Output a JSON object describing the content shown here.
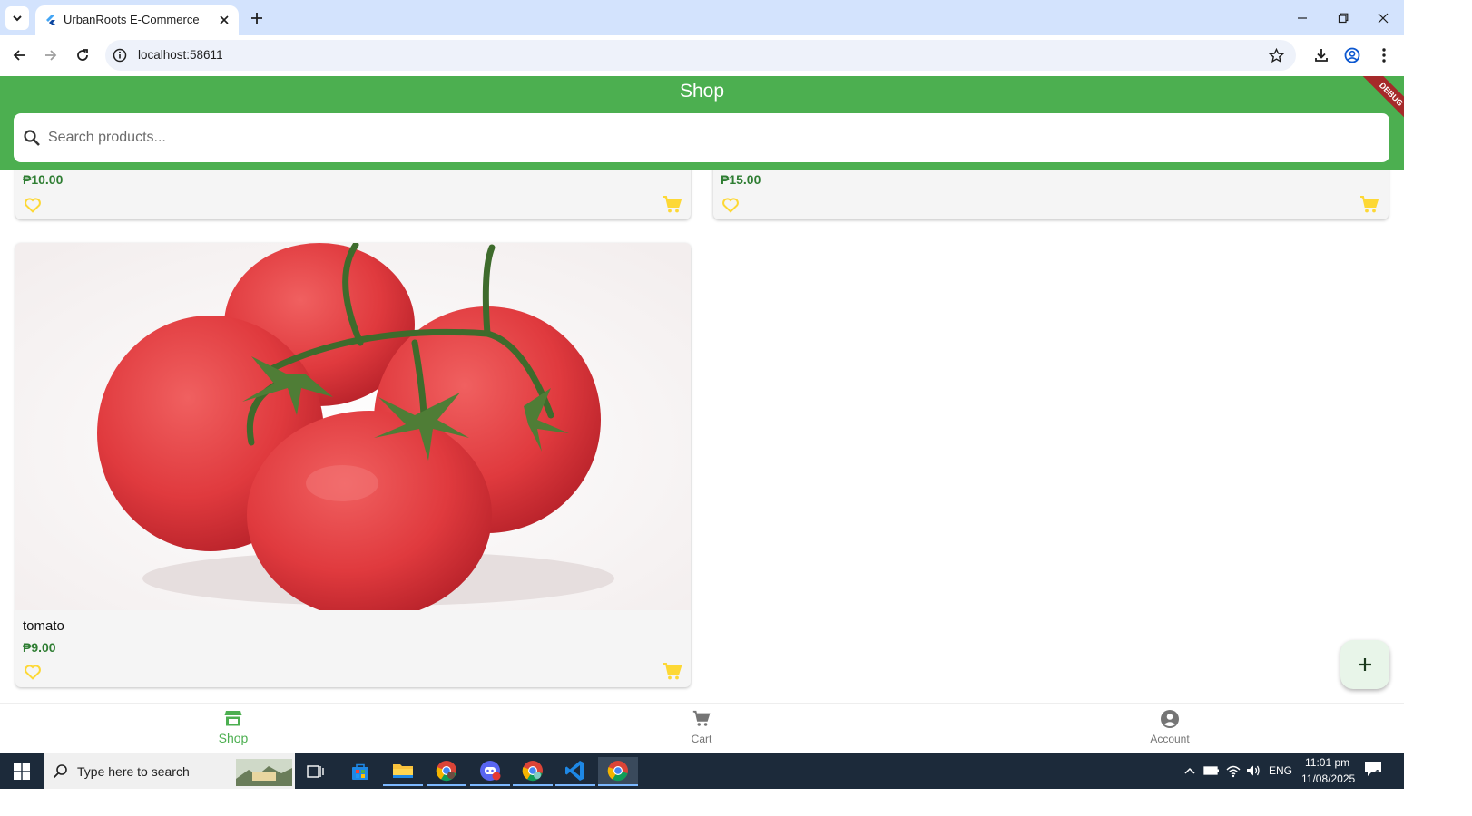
{
  "browser": {
    "tab_title": "UrbanRoots E-Commerce",
    "url": "localhost:58611"
  },
  "app": {
    "title": "Shop",
    "debug_banner": "DEBUG",
    "search_placeholder": "Search products...",
    "products": [
      {
        "name": "",
        "price": "₱10.00"
      },
      {
        "name": "",
        "price": "₱15.00"
      },
      {
        "name": "tomato",
        "price": "₱9.00"
      }
    ],
    "accent_color": "#4caf50",
    "price_color": "#2e7d32",
    "icon_color": "#fdd835"
  },
  "bottom_nav": {
    "items": [
      {
        "label": "Shop",
        "icon": "store-icon",
        "active": true
      },
      {
        "label": "Cart",
        "icon": "cart-icon",
        "active": false
      },
      {
        "label": "Account",
        "icon": "account-icon",
        "active": false
      }
    ]
  },
  "taskbar": {
    "search_placeholder": "Type here to search",
    "language": "ENG",
    "time": "11:01 pm",
    "date": "11/08/2025",
    "notification_count": "1"
  }
}
